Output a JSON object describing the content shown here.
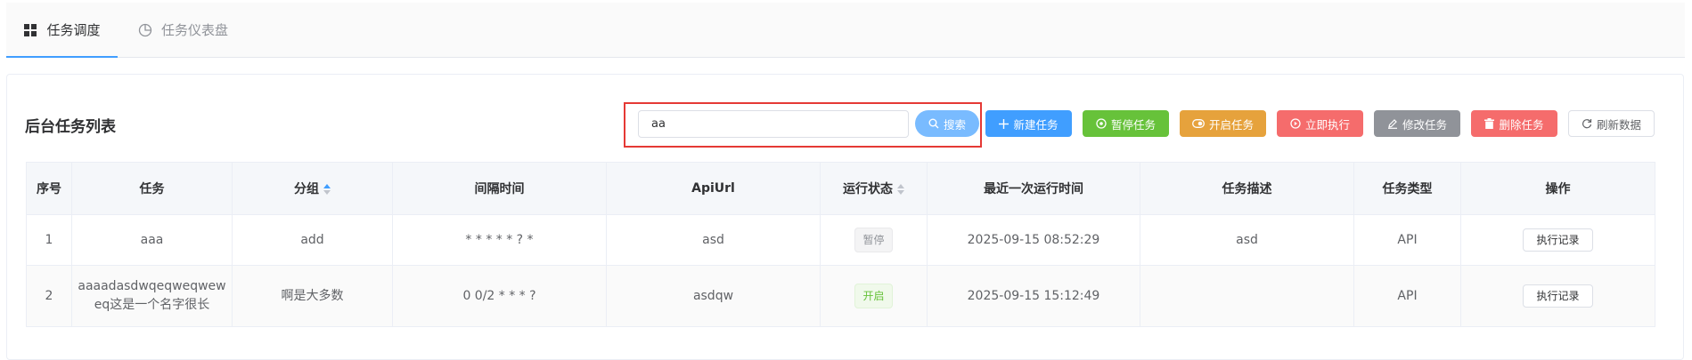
{
  "tabs": [
    {
      "label": "任务调度",
      "icon": "grid-icon",
      "active": true
    },
    {
      "label": "任务仪表盘",
      "icon": "pie-chart-icon",
      "active": false
    }
  ],
  "card": {
    "title": "后台任务列表"
  },
  "search": {
    "value": "aa",
    "button_label": "搜索"
  },
  "toolbar": {
    "new_label": "新建任务",
    "pause_label": "暂停任务",
    "start_label": "开启任务",
    "run_label": "立即执行",
    "edit_label": "修改任务",
    "delete_label": "删除任务",
    "refresh_label": "刷新数据"
  },
  "table": {
    "columns": [
      "序号",
      "任务",
      "分组",
      "间隔时间",
      "ApiUrl",
      "运行状态",
      "最近一次运行时间",
      "任务描述",
      "任务类型",
      "操作"
    ],
    "rows": [
      {
        "index": "1",
        "task": "aaa",
        "group": "add",
        "interval": "* * * * * ? *",
        "apiurl": "asd",
        "status": "暂停",
        "last_run": "2025-09-15 08:52:29",
        "description": "asd",
        "type": "API",
        "action": "执行记录"
      },
      {
        "index": "2",
        "task": "aaaadasdwqeqweqweweq这是一个名字很长",
        "group": "啊是大多数",
        "interval": "0 0/2 * * * ?",
        "apiurl": "asdqw",
        "status": "开启",
        "last_run": "2025-09-15 15:12:49",
        "description": "",
        "type": "API",
        "action": "执行记录"
      }
    ]
  },
  "colors": {
    "primary": "#409eff",
    "success": "#67c23a",
    "warning": "#e6a23c",
    "danger": "#f56c6c",
    "info": "#909399",
    "highlight": "#e53935"
  }
}
